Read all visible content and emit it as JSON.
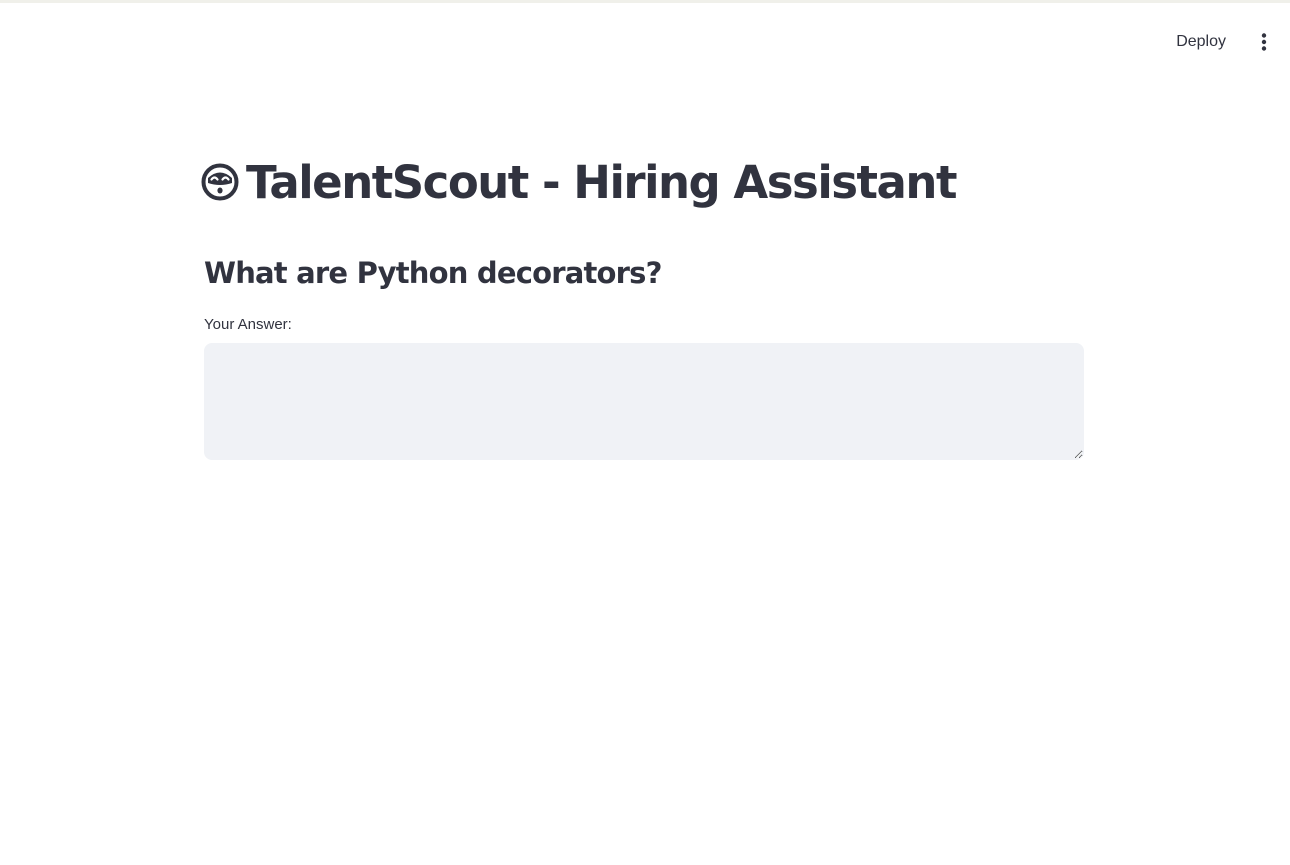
{
  "header": {
    "deploy_label": "Deploy",
    "menu_icon": "kebab-menu-icon"
  },
  "main": {
    "title_icon": "robot-face-icon",
    "title": "TalentScout - Hiring Assistant",
    "question": "What are Python decorators?",
    "answer_label": "Your Answer:",
    "answer_value": "",
    "answer_placeholder": ""
  },
  "colors": {
    "text": "#31333f",
    "input_background": "#f0f2f6",
    "top_border": "#f0f0ea"
  }
}
